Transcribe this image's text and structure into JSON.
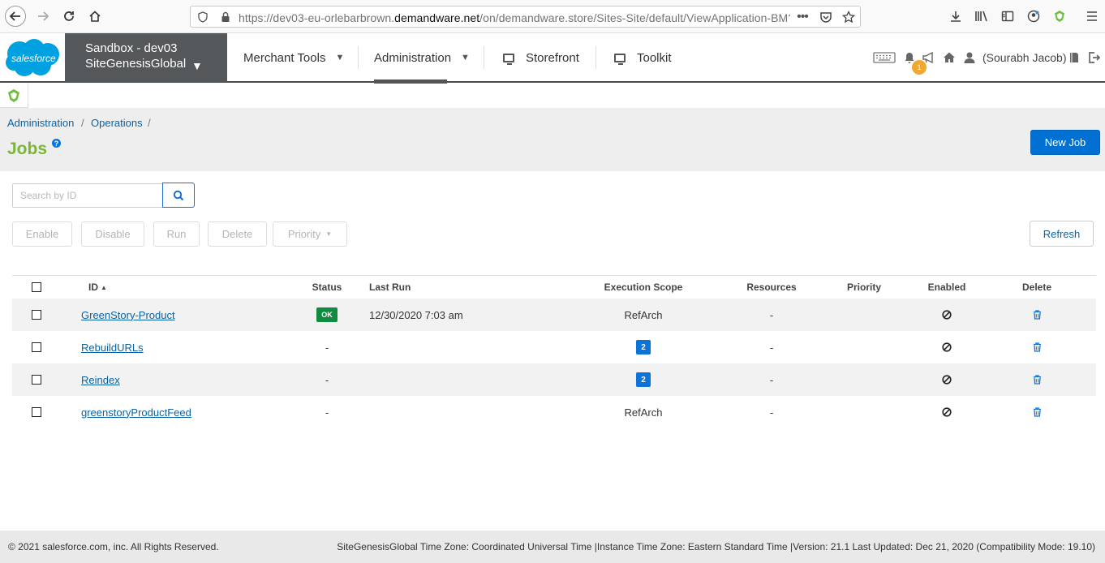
{
  "browser": {
    "url_prefix": "https://dev03-eu-orlebarbrown.",
    "url_domain": "demandware.net",
    "url_suffix": "/on/demandware.store/Sites-Site/default/ViewApplication-BM?"
  },
  "header": {
    "logo_text": "salesforce",
    "site_line1": "Sandbox - dev03",
    "site_line2": "SiteGenesisGlobal",
    "menu": [
      "Merchant Tools",
      "Administration",
      "Storefront",
      "Toolkit"
    ],
    "notification_count": "1",
    "user": "(Sourabh Jacob)"
  },
  "breadcrumb": [
    "Administration",
    "Operations"
  ],
  "page": {
    "title": "Jobs",
    "new_job": "New Job"
  },
  "search": {
    "placeholder": "Search by ID"
  },
  "actions": {
    "enable": "Enable",
    "disable": "Disable",
    "run": "Run",
    "delete": "Delete",
    "priority": "Priority",
    "refresh": "Refresh"
  },
  "table": {
    "headers": {
      "id": "ID",
      "status": "Status",
      "last_run": "Last Run",
      "execution_scope": "Execution Scope",
      "resources": "Resources",
      "priority": "Priority",
      "enabled": "Enabled",
      "delete": "Delete"
    },
    "rows": [
      {
        "id": "GreenStory-Product",
        "status": "OK",
        "last_run": "12/30/2020 7:03 am",
        "scope": "RefArch",
        "resources": "-"
      },
      {
        "id": "RebuildURLs",
        "status": "-",
        "last_run": "",
        "scope": "2",
        "resources": "-"
      },
      {
        "id": "Reindex",
        "status": "-",
        "last_run": "",
        "scope": "2",
        "resources": "-"
      },
      {
        "id": "greenstoryProductFeed",
        "status": "-",
        "last_run": "",
        "scope": "RefArch",
        "resources": "-"
      }
    ]
  },
  "footer": {
    "copyright": "© 2021 salesforce.com, inc. All Rights Reserved.",
    "info": "SiteGenesisGlobal Time Zone: Coordinated Universal Time |Instance Time Zone: Eastern Standard Time |Version: 21.1 Last Updated: Dec 21, 2020 (Compatibility Mode: 19.10)"
  }
}
